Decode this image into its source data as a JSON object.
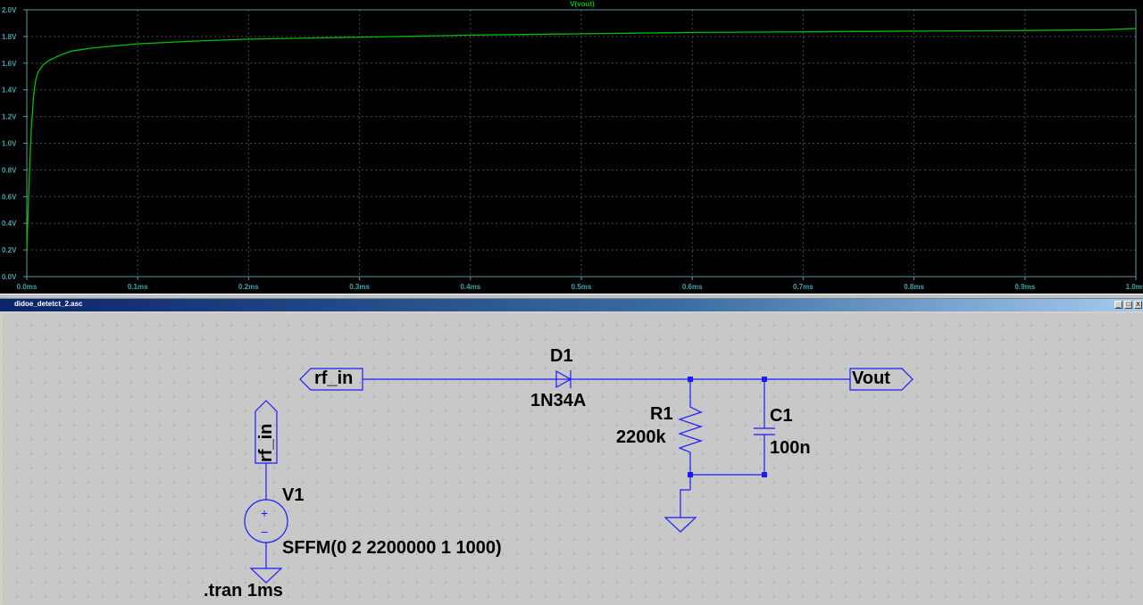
{
  "plot": {
    "trace_title": "V(vout)",
    "colors": {
      "background": "#000000",
      "grid": "#4a4a4a",
      "axis": "#5a9aa0",
      "tick_text": "#4aa0a8",
      "trace": "#00c000"
    }
  },
  "chart_data": {
    "type": "line",
    "title": "V(vout)",
    "xlabel": "",
    "ylabel": "",
    "xlim": [
      0,
      1.0
    ],
    "ylim": [
      0,
      2.0
    ],
    "x_unit": "ms",
    "y_unit": "V",
    "grid": true,
    "x_ticks": [
      "0.0ms",
      "0.1ms",
      "0.2ms",
      "0.3ms",
      "0.4ms",
      "0.5ms",
      "0.6ms",
      "0.7ms",
      "0.8ms",
      "0.9ms",
      "1.0ms"
    ],
    "y_ticks": [
      "0.0V",
      "0.2V",
      "0.4V",
      "0.6V",
      "0.8V",
      "1.0V",
      "1.2V",
      "1.4V",
      "1.6V",
      "1.8V",
      "2.0V"
    ],
    "series": [
      {
        "name": "V(vout)",
        "x": [
          0,
          0.002,
          0.004,
          0.006,
          0.008,
          0.01,
          0.015,
          0.02,
          0.03,
          0.04,
          0.06,
          0.08,
          0.1,
          0.15,
          0.2,
          0.3,
          0.4,
          0.5,
          0.6,
          0.7,
          0.8,
          0.9,
          0.97,
          1.0
        ],
        "y": [
          0.2,
          0.7,
          1.1,
          1.35,
          1.47,
          1.53,
          1.59,
          1.62,
          1.66,
          1.69,
          1.715,
          1.73,
          1.745,
          1.765,
          1.78,
          1.795,
          1.81,
          1.82,
          1.83,
          1.835,
          1.84,
          1.845,
          1.85,
          1.86
        ]
      }
    ]
  },
  "window": {
    "title": "didoe_detetct_2.asc",
    "minimize_label": "_",
    "maximize_label": "□",
    "close_label": "X"
  },
  "schematic": {
    "colors": {
      "wire": "#1a1aff",
      "background": "#c8c8c8",
      "text": "#000000"
    },
    "net_rf_in_label": "rf_in",
    "net_vout_label": "Vout",
    "source_net_label": "rf_in",
    "diode_name": "D1",
    "diode_value": "1N34A",
    "resistor_name": "R1",
    "resistor_value": "2200k",
    "capacitor_name": "C1",
    "capacitor_value": "100n",
    "source_name": "V1",
    "source_value": "SFFM(0 2 2200000 1 1000)",
    "directive": ".tran 1ms",
    "plus_sign": "+",
    "minus_sign": "−"
  }
}
